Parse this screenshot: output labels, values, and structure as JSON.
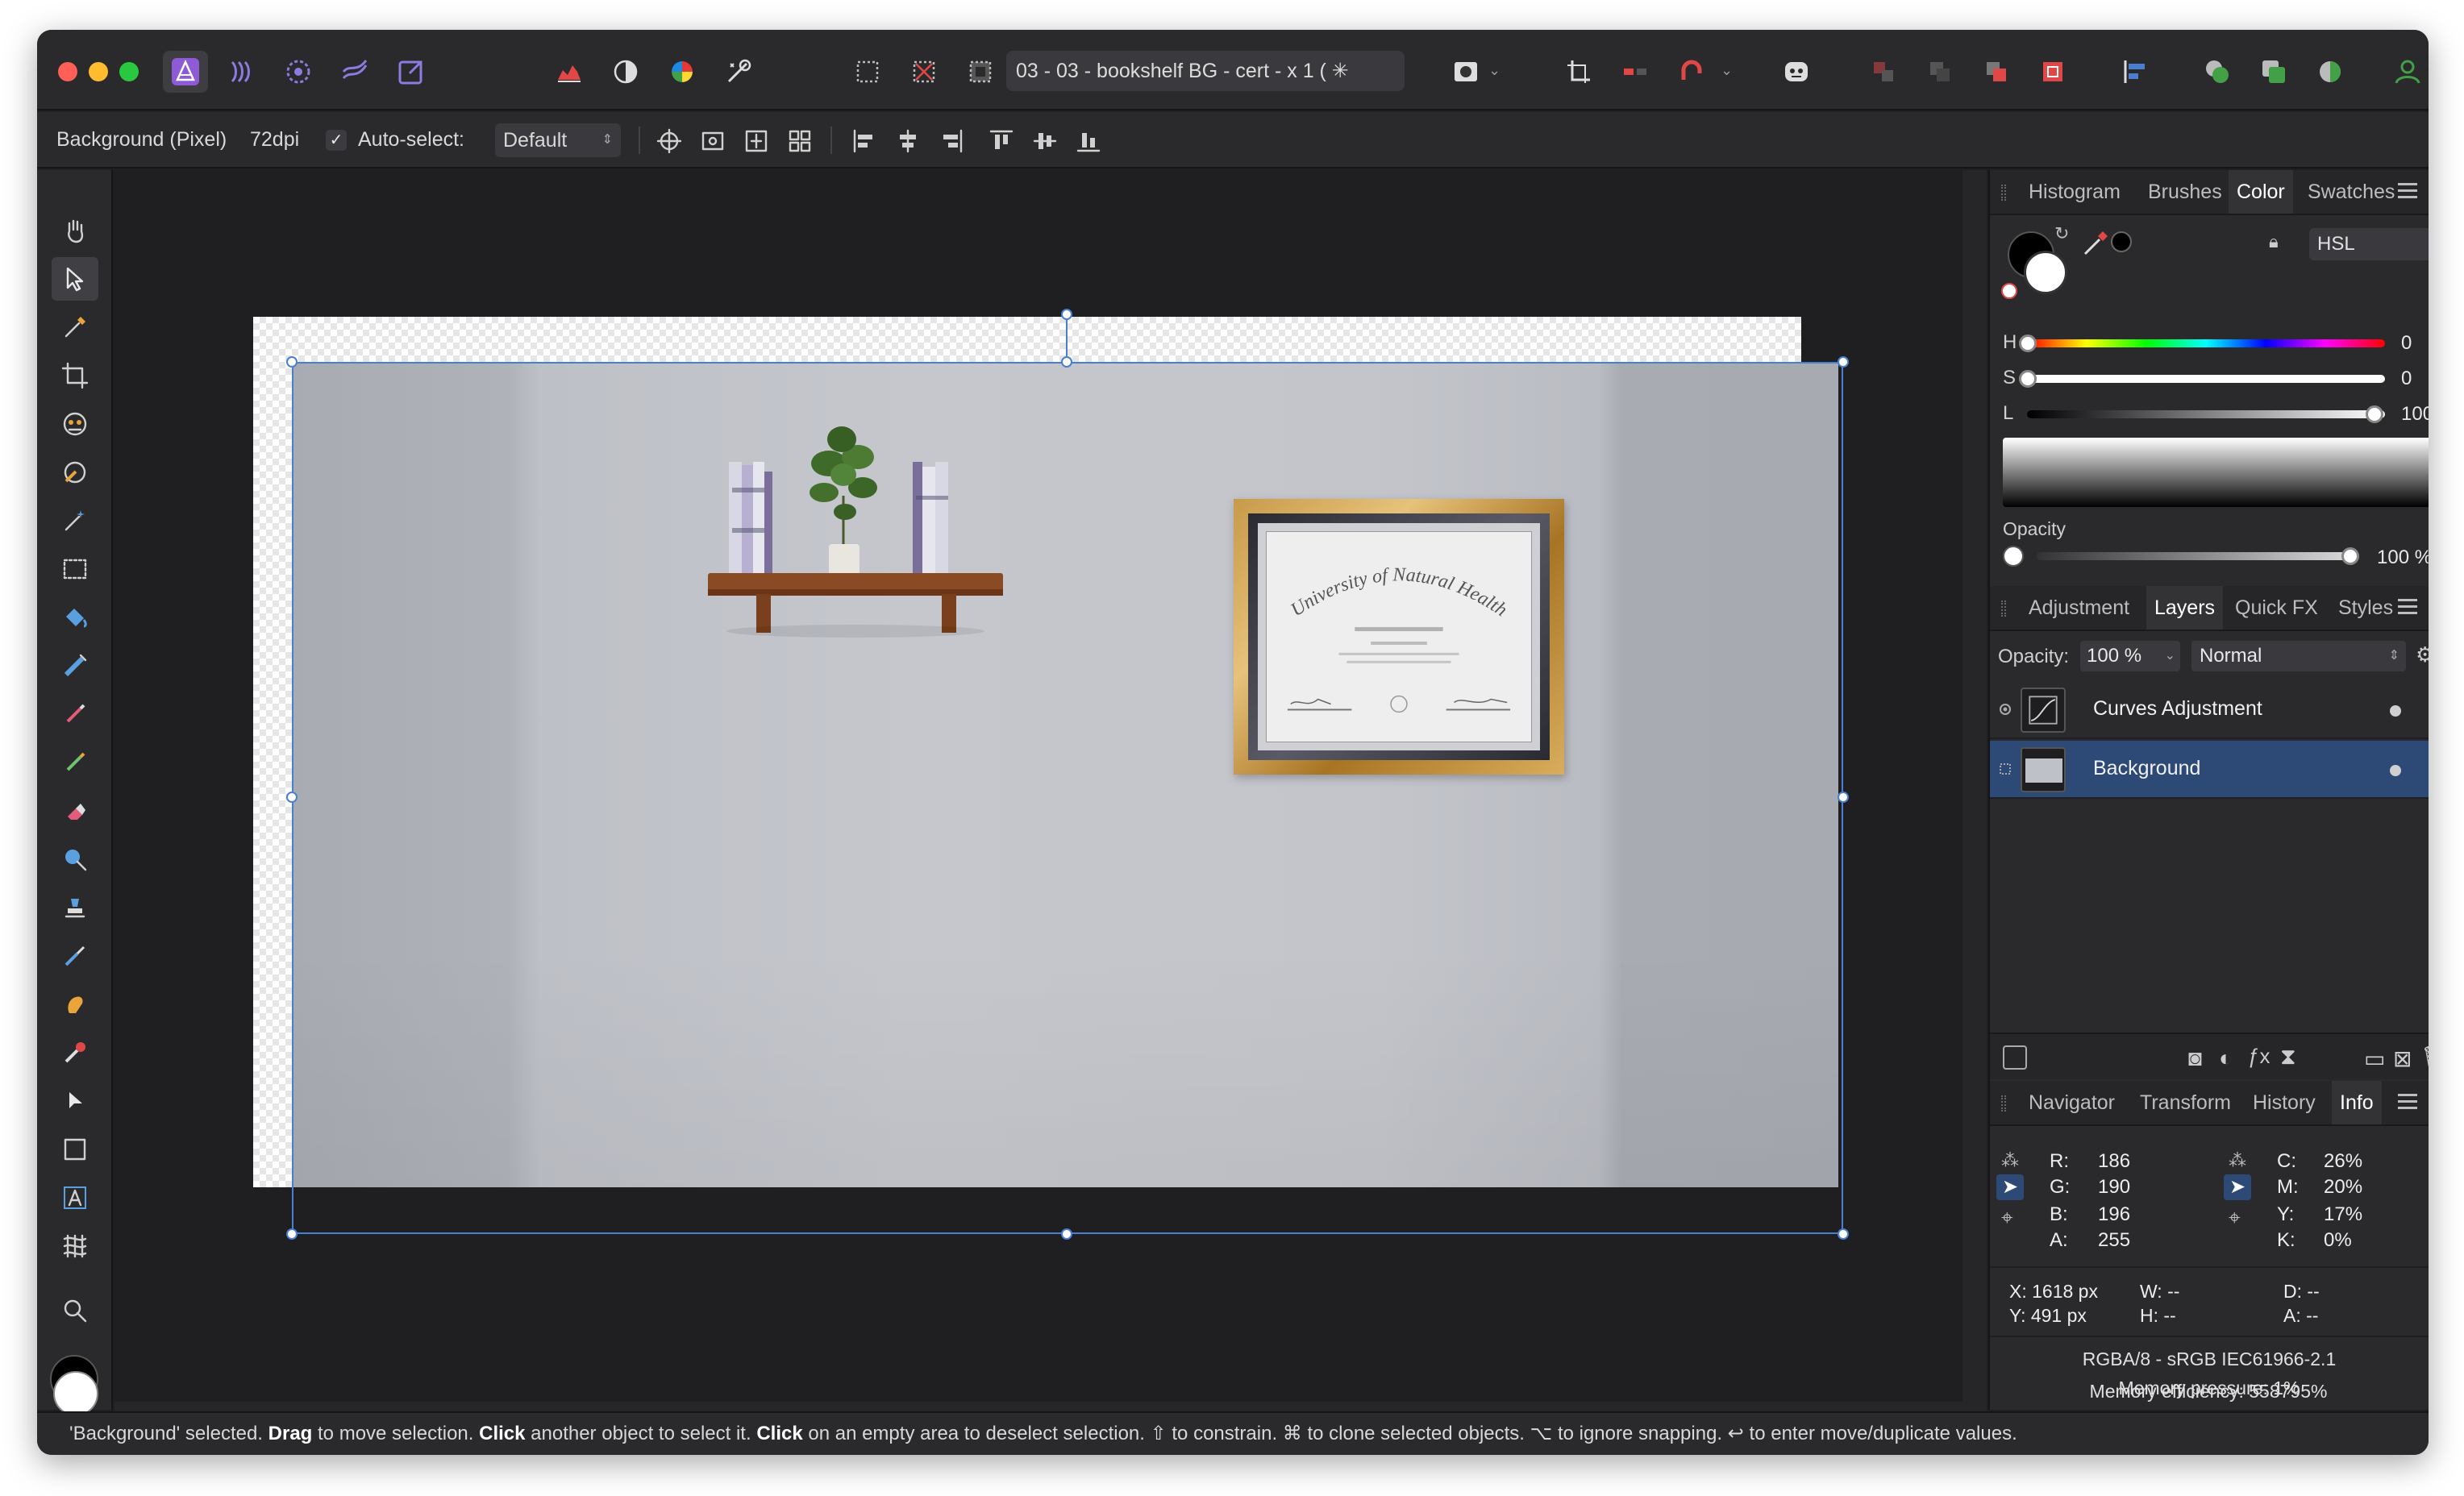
{
  "document": {
    "title": "03 - 03 - bookshelf BG - cert - x 1 ( ✳"
  },
  "context_toolbar": {
    "layer_label": "Background (Pixel)",
    "dpi": "72dpi",
    "auto_select_label": "Auto-select:",
    "auto_select_value": "Default",
    "check": "✓"
  },
  "color_panel": {
    "tabs": [
      "Histogram",
      "Brushes",
      "Color",
      "Swatches"
    ],
    "active_tab": "Color",
    "mode": "HSL",
    "h_label": "H",
    "h_value": "0",
    "s_label": "S",
    "s_value": "0",
    "l_label": "L",
    "l_value": "100",
    "l_level": 1.0,
    "opacity_label": "Opacity",
    "opacity_value": "100 %",
    "opacity_level": 1.0
  },
  "layers_panel": {
    "tabs": [
      "Adjustment",
      "Layers",
      "Quick FX",
      "Styles"
    ],
    "active_tab": "Layers",
    "opacity_label": "Opacity:",
    "opacity_value": "100 %",
    "blend_mode": "Normal",
    "layers": [
      {
        "name": "Curves Adjustment",
        "selected": false
      },
      {
        "name": "Background",
        "selected": true
      }
    ]
  },
  "info_panel": {
    "tabs": [
      "Navigator",
      "Transform",
      "History",
      "Info"
    ],
    "active_tab": "Info",
    "rgb": [
      {
        "label": "R:",
        "value": "186"
      },
      {
        "label": "G:",
        "value": "190"
      },
      {
        "label": "B:",
        "value": "196"
      },
      {
        "label": "A:",
        "value": "255"
      }
    ],
    "cmyk": [
      {
        "label": "C:",
        "value": "26%"
      },
      {
        "label": "M:",
        "value": "20%"
      },
      {
        "label": "Y:",
        "value": "17%"
      },
      {
        "label": "K:",
        "value": "0%"
      }
    ],
    "x": "X: 1618 px",
    "y": "Y: 491 px",
    "w": "W: --",
    "h": "H: --",
    "d": "D: --",
    "a": "A: --",
    "color_profile": "RGBA/8 - sRGB IEC61966-2.1",
    "memory_pressure": "Memory pressure: 1%",
    "memory_efficiency": "Memory efficiency: 558795%"
  },
  "certificate": {
    "heading": "University of Natural Health"
  },
  "status": {
    "part1": "'Background' selected. ",
    "drag": "Drag",
    "part2": " to move selection. ",
    "click1": "Click",
    "part3": " another object to select it. ",
    "click2": "Click",
    "part4": " on an empty area to deselect selection. ⇧ to constrain. ⌘ to clone selected objects. ⌥ to ignore snapping. ↩ to enter move/duplicate values."
  },
  "colors": {
    "accent": "#4a7fd0",
    "selected_layer": "#2d4a76",
    "panel": "#2a2a2c",
    "canvas_bg": "#1f1f21"
  }
}
